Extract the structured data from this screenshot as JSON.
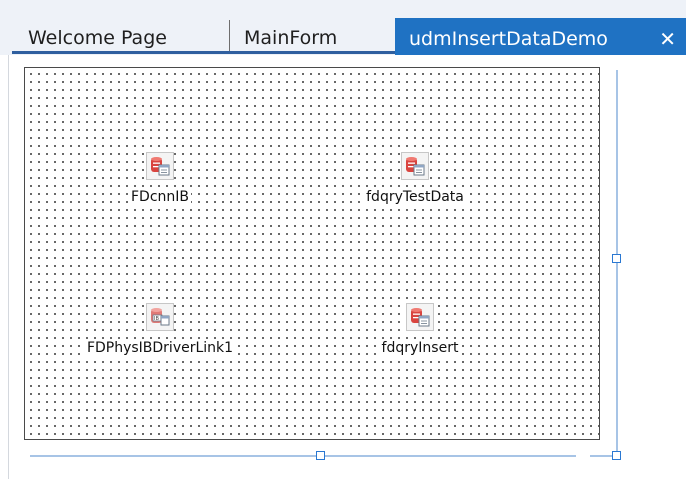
{
  "tabs": [
    {
      "label": "Welcome Page",
      "active": false
    },
    {
      "label": "MainForm",
      "active": false
    },
    {
      "label": "udmInsertDataDemo",
      "active": true,
      "close_glyph": "✕"
    }
  ],
  "components": [
    {
      "label": "FDcnnIB",
      "icon": "database-icon"
    },
    {
      "label": "fdqryTestData",
      "icon": "database-icon"
    },
    {
      "label": "FDPhysIBDriverLink1",
      "icon": "ib-driver-icon"
    },
    {
      "label": "fdqryInsert",
      "icon": "database-icon"
    }
  ],
  "colors": {
    "active_tab": "#1f72c3",
    "tab_underline": "#2f5f9f",
    "selection_handle": "#2a78d2",
    "db_icon": "#d9443f"
  }
}
